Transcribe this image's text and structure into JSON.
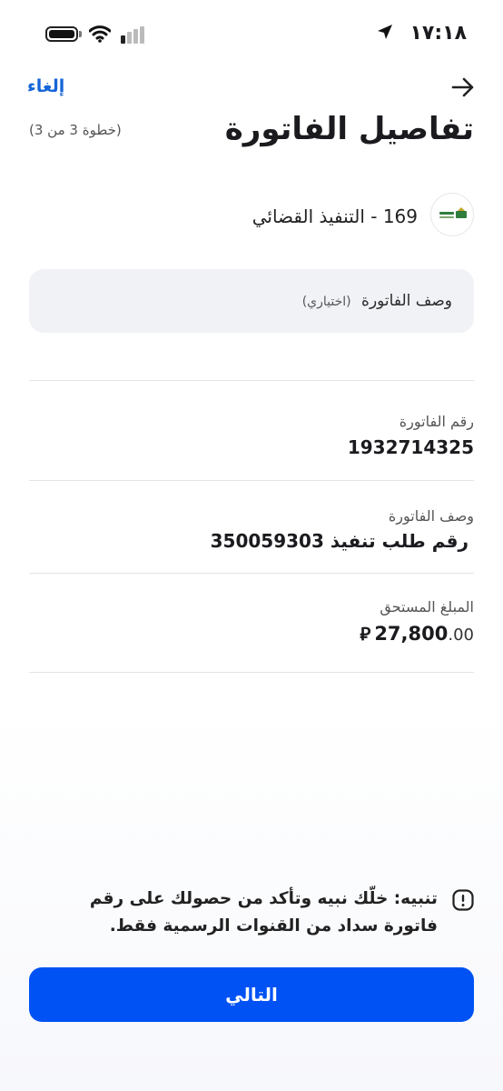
{
  "status_bar": {
    "time": "١٧:١٨"
  },
  "header": {
    "cancel_label": "إلغاء",
    "title": "تفاصيل الفاتورة",
    "step_text": "(خطوة 3 من 3)"
  },
  "biller": {
    "name": "169 - التنفيذ القضائي"
  },
  "description_field": {
    "placeholder": "وصف الفاتورة",
    "optional_tag": "(اختياري)"
  },
  "details": [
    {
      "label": "رقم الفاتورة",
      "value": "1932714325"
    },
    {
      "label": "وصف الفاتورة",
      "value": "رقم طلب تنفيذ 350059303"
    },
    {
      "label": "المبلغ المستحق",
      "amount_integer": "27,800",
      "amount_decimal": ".00",
      "currency_symbol": "⃁"
    }
  ],
  "notice": {
    "text": "تنبيه: خلّك نبيه وتأكد من حصولك على رقم فاتورة سداد من القنوات الرسمية فقط."
  },
  "next_button": {
    "label": "التالي"
  },
  "colors": {
    "accent": "#0052f5",
    "link": "#1565d8",
    "field_bg": "#f1f2f6",
    "divider": "#e4e4e8"
  },
  "icons": {
    "back": "arrow-right-icon",
    "location": "location-arrow-icon",
    "wifi": "wifi-icon",
    "battery": "battery-icon",
    "signal": "cellular-signal-icon",
    "notice": "exclamation-icon",
    "biller_logo": "biller-logo"
  }
}
